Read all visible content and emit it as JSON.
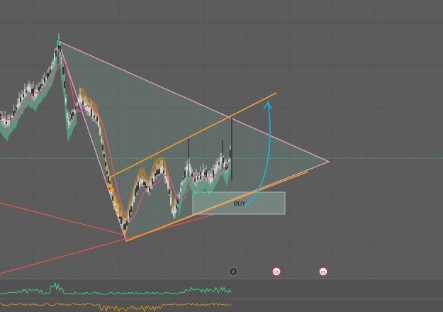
{
  "chart": {
    "annotation_label": "BUY",
    "colors": {
      "background": "#5c5c5c",
      "candle": "#e8e8e8",
      "band_fill": "#7fb7a0",
      "band_orange": "#d98e1f",
      "band_green": "#2fb36e",
      "ma_pink": "#d4587a",
      "triangle_stroke": "#d9a0b4",
      "channel_orange": "#f0a020",
      "trend_red": "#e05050",
      "arrow_cyan": "#19b5d6",
      "indicator_green": "#3ad07a",
      "indicator_orange": "#d88a20"
    },
    "event_icons": [
      {
        "name": "flash-icon",
        "glyph": "⚡"
      },
      {
        "name": "us-flag-icon",
        "glyph": "US"
      },
      {
        "name": "us-flag-icon",
        "glyph": "US"
      }
    ]
  }
}
